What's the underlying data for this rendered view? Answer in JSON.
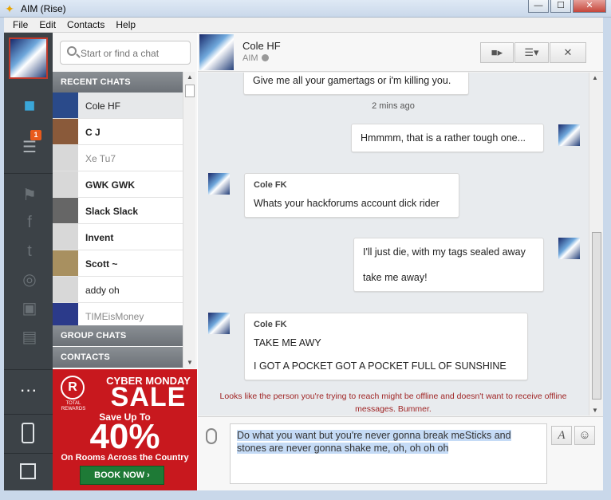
{
  "window": {
    "title": "AIM (Rise)",
    "minimize": "—",
    "maximize": "☐",
    "close": "✕"
  },
  "menu": [
    "File",
    "Edit",
    "Contacts",
    "Help"
  ],
  "rail": {
    "badge_count": "1",
    "more": "···"
  },
  "search": {
    "placeholder": "Start or find a chat"
  },
  "sections": {
    "recent": "RECENT CHATS",
    "group": "GROUP CHATS",
    "contacts": "CONTACTS"
  },
  "contacts": [
    {
      "name": "Cole HF",
      "style": "normal",
      "selected": true,
      "pic": "#2a4a8a"
    },
    {
      "name": "C J",
      "style": "bold",
      "selected": false,
      "pic": "#8a5a3a"
    },
    {
      "name": "Xe Tu7",
      "style": "muted",
      "selected": false,
      "pic": "#d8d8d8"
    },
    {
      "name": "GWK GWK",
      "style": "bold",
      "selected": false,
      "pic": "#d8d8d8"
    },
    {
      "name": "Slack Slack",
      "style": "bold",
      "selected": false,
      "pic": "#666666"
    },
    {
      "name": "Invent",
      "style": "bold",
      "selected": false,
      "pic": "#d8d8d8"
    },
    {
      "name": "Scott ~",
      "style": "bold",
      "selected": false,
      "pic": "#a89060"
    },
    {
      "name": "addy oh",
      "style": "normal",
      "selected": false,
      "pic": "#d8d8d8"
    },
    {
      "name": "TIMEisMoney",
      "style": "muted",
      "selected": false,
      "pic": "#2b3a8a"
    }
  ],
  "ad": {
    "logo": "R",
    "logo_text": "TOTAL REWARDS",
    "headline": "CYBER MONDAY",
    "sale": "SALE",
    "save_up_to": "Save Up To",
    "percent": "40%",
    "rooms": "On Rooms Across the Country",
    "cta": "BOOK NOW ›"
  },
  "chat": {
    "contact_name": "Cole HF",
    "status": "AIM",
    "messages": [
      {
        "text": "Give me all your gamertags or i'm killing you."
      },
      {
        "text": "Hmmmm, that is a rather tough one..."
      },
      {
        "sender": "Cole FK",
        "text": "Whats your hackforums account dick rider"
      },
      {
        "line1": "I'll just die, with my tags sealed away",
        "line2": "take me away!"
      },
      {
        "sender": "Cole FK",
        "line1": "TAKE ME AWY",
        "line2": "I GOT A POCKET GOT A POCKET FULL OF SUNSHINE"
      }
    ],
    "timestamp": "2 mins ago",
    "offline_notice": "Looks like the person you're trying to reach might be offline and doesn't want to receive offline messages. Bummer."
  },
  "composer": {
    "text": "Do what you want but you're never gonna break meSticks and stones are never gonna shake me, oh, oh oh oh",
    "format_label": "A",
    "emoji_label": "☺"
  }
}
